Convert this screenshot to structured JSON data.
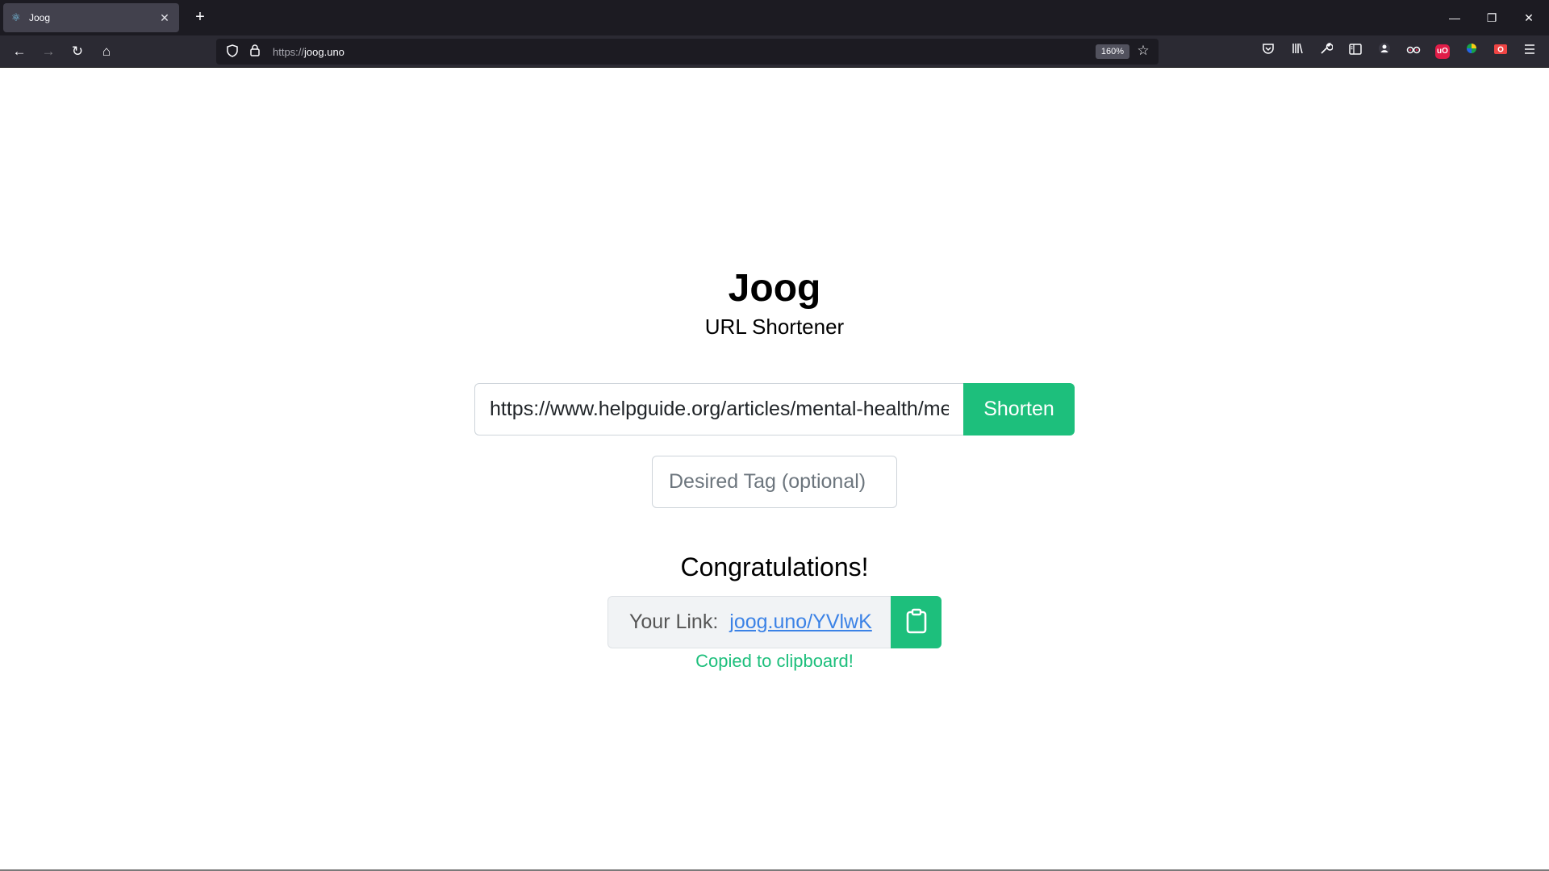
{
  "browser": {
    "tab_title": "Joog",
    "tab_close": "✕",
    "new_tab": "+",
    "url_scheme": "https://",
    "url_host": "joog.uno",
    "zoom": "160%",
    "window": {
      "minimize": "—",
      "restore": "❐",
      "close": "✕"
    },
    "nav": {
      "back": "←",
      "forward": "→",
      "reload": "↻",
      "home": "⌂"
    }
  },
  "toolbar_extensions": [
    {
      "name": "ublock",
      "label": "uO",
      "color": "#e11d48"
    },
    {
      "name": "screenshot",
      "label": "●",
      "color": "#ef4444"
    }
  ],
  "page": {
    "brand": "Joog",
    "subtitle": "URL Shortener",
    "url_input_value": "https://www.helpguide.org/articles/mental-health/mental-health-tips",
    "shorten_label": "Shorten",
    "tag_placeholder": "Desired Tag (optional)",
    "congrats": "Congratulations!",
    "link_label": "Your Link:",
    "short_link": "joog.uno/YVlwK",
    "copied_message": "Copied to clipboard!"
  },
  "colors": {
    "accent_green": "#1dbf7c",
    "link_blue": "#3b82e6"
  }
}
